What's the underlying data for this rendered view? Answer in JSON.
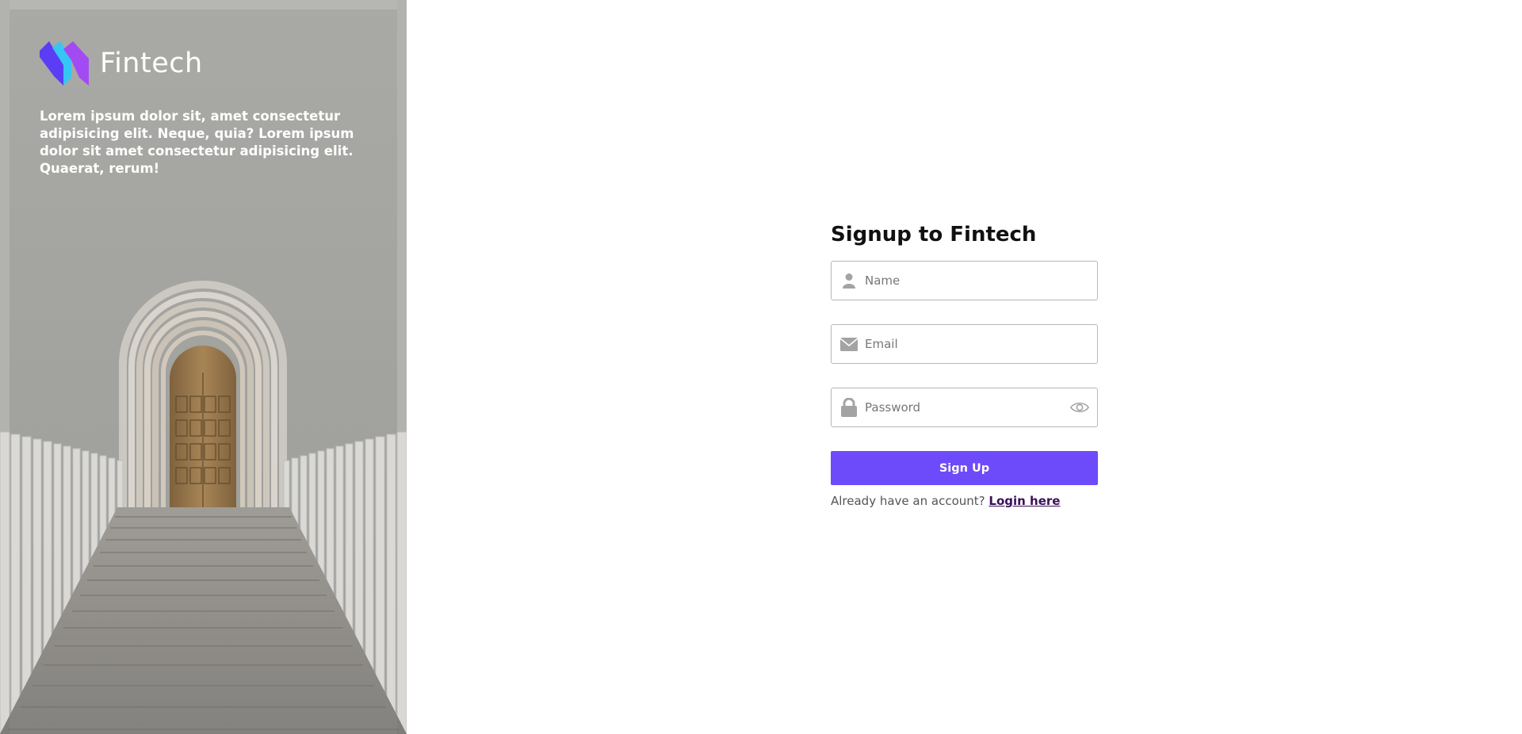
{
  "brand": {
    "name": "Fintech",
    "logo_icon": "fintech-logo-icon",
    "logo_colors": [
      "#5b3df5",
      "#a24bf3",
      "#36c6f4"
    ]
  },
  "hero": {
    "text": "Lorem ipsum dolor sit, amet consectetur adipisicing elit. Neque, quia? Lorem ipsum dolor sit amet consectetur adipisicing elit. Quaerat, rerum!"
  },
  "form": {
    "title": "Signup to Fintech",
    "name": {
      "placeholder": "Name",
      "value": "",
      "icon": "user-icon"
    },
    "email": {
      "placeholder": "Email",
      "value": "",
      "icon": "envelope-icon"
    },
    "password": {
      "placeholder": "Password",
      "value": "",
      "icon": "lock-icon",
      "toggle_icon": "eye-icon"
    },
    "submit_label": "Sign Up",
    "login_prompt": "Already have an account?",
    "login_link": "Login here"
  },
  "colors": {
    "accent": "#6e4bfa",
    "link": "#3b0f5a"
  }
}
